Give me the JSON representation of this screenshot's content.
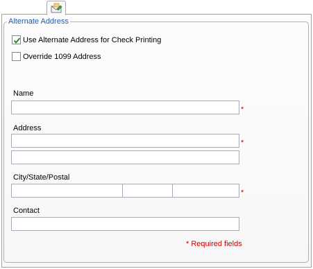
{
  "tab": {
    "icon": "envelope-edit-icon"
  },
  "group": {
    "title": "Alternate Address",
    "use_alternate": {
      "label": "Use Alternate Address for Check Printing",
      "checked": true
    },
    "override_1099": {
      "label": "Override 1099 Address",
      "checked": false
    }
  },
  "form": {
    "name_label": "Name",
    "name_value": "",
    "address_label": "Address",
    "address_line1": "",
    "address_line2": "",
    "city_label": "City/State/Postal",
    "city_value": "",
    "state_value": "",
    "postal_value": "",
    "contact_label": "Contact",
    "contact_value": "",
    "required_marker": "*"
  },
  "footer": {
    "required_note": "* Required fields"
  },
  "colors": {
    "legend": "#1e5aa8",
    "required": "#cc0000",
    "check": "#2a8a2a"
  }
}
